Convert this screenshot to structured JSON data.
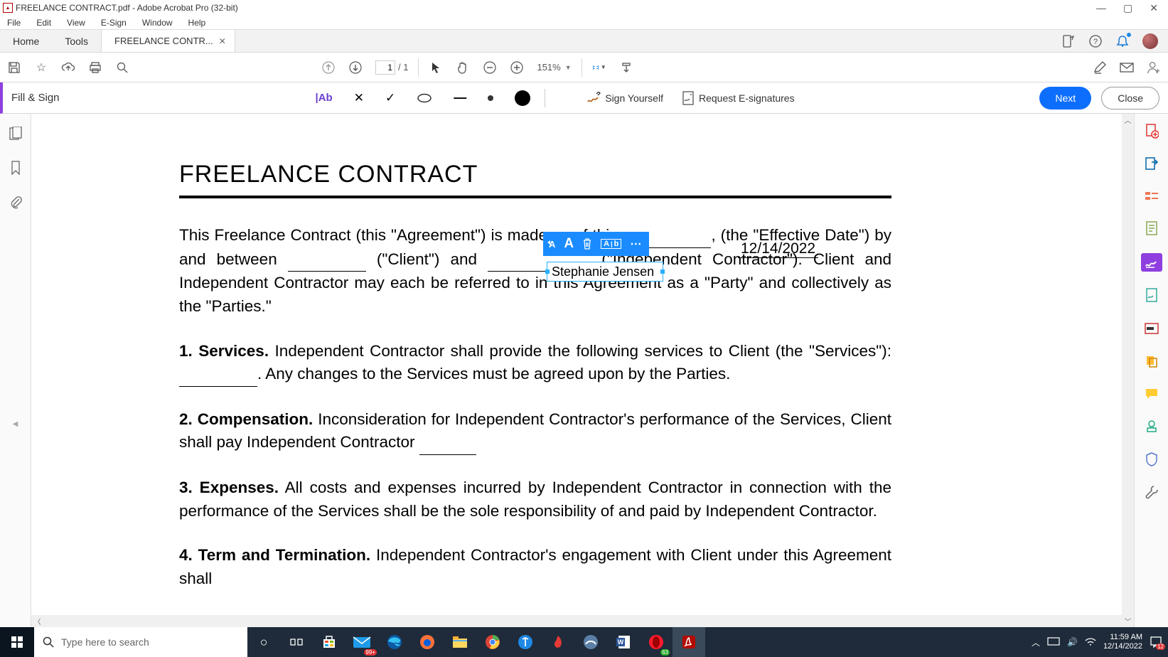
{
  "window": {
    "title": "FREELANCE CONTRACT.pdf - Adobe Acrobat Pro (32-bit)"
  },
  "menu": [
    "File",
    "Edit",
    "View",
    "E-Sign",
    "Window",
    "Help"
  ],
  "tabs": {
    "home": "Home",
    "tools": "Tools",
    "doc": "FREELANCE CONTR..."
  },
  "toolbar": {
    "page_current": "1",
    "page_total": "/ 1",
    "zoom": "151%"
  },
  "fill_sign": {
    "label": "Fill & Sign",
    "text_tool": "|Ab",
    "sign_yourself": "Sign Yourself",
    "request": "Request E-signatures",
    "next": "Next",
    "close": "Close"
  },
  "context_toolbar": {
    "ab": "A̲b̲"
  },
  "document": {
    "title": "FREELANCE CONTRACT",
    "intro_1": "This Freelance Contract (this \"Agreement\") is made as of this ",
    "intro_2": ", (the \"Effective Date\") by and between ",
    "intro_3": " (\"Client\") and ",
    "intro_4": " (\"Independent Contractor\"). Client and Independent Contractor may each be referred to in this Agreement as a \"Party\" and collectively as the \"Parties.\"",
    "p1_a": "1.  Services.",
    "p1_b": " Independent Contractor shall provide the following services to Client (the \"Services\"): ",
    "p1_c": ". Any changes to the Services must be agreed upon by the Parties.",
    "p2_a": "2. Compensation.",
    "p2_b": " Inconsideration for Independent Contractor's performance of the Services, Client shall pay Independent Contractor ",
    "p3_a": "3. Expenses.",
    "p3_b": " All costs and expenses incurred by Independent Contractor in connection with the performance of the Services shall be the sole responsibility of and paid by Independent Contractor.",
    "p4_a": "4. Term and Termination.",
    "p4_b": " Independent Contractor's engagement with Client under this Agreement shall",
    "fill_date": "12/14/2022",
    "fill_name": "Stephanie Jensen"
  },
  "taskbar": {
    "search_placeholder": "Type here to search",
    "time": "11:59 AM",
    "date": "12/14/2022",
    "notif_badge": "99+",
    "teams_badge": "12"
  }
}
